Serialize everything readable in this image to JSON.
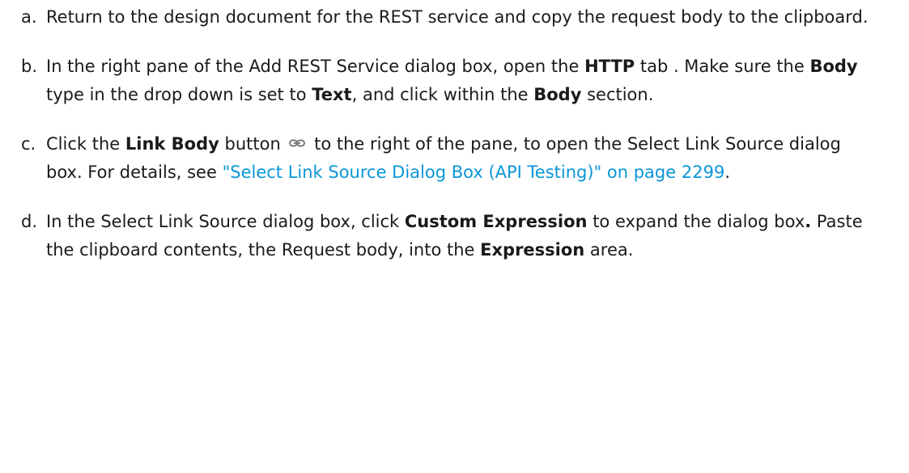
{
  "steps": [
    {
      "marker": "a.",
      "parts": {
        "t1": "Return to the design document for the REST service and copy the request body to the clipboard."
      }
    },
    {
      "marker": "b.",
      "parts": {
        "t1": "In the right pane of the Add REST Service dialog box, open the ",
        "b1": "HTTP",
        "t2": " tab . Make sure the ",
        "b2": "Body",
        "t3": " type in the drop down is set to ",
        "b3": "Text",
        "t4": ", and click within the ",
        "b4": "Body",
        "t5": " section."
      }
    },
    {
      "marker": "c.",
      "parts": {
        "t1": "Click the ",
        "b1": "Link Body",
        "t2": " button ",
        "icon": "link-icon",
        "t3": " to the right of the pane, to open the Select Link Source dialog box. For details, see ",
        "link": "\"Select Link Source Dialog Box (API Testing)\" on page 2299",
        "t4": "."
      }
    },
    {
      "marker": "d.",
      "parts": {
        "t1": "In the Select Link Source dialog box, click ",
        "b1": "Custom Expression",
        "t2": " to expand the dialog box",
        "b2": ".",
        "t3": " Paste the clipboard contents, the Request body, into the ",
        "b3": "Expression",
        "t4": " area."
      }
    }
  ],
  "colors": {
    "text": "#1a1a1a",
    "link": "#0a96d7"
  }
}
